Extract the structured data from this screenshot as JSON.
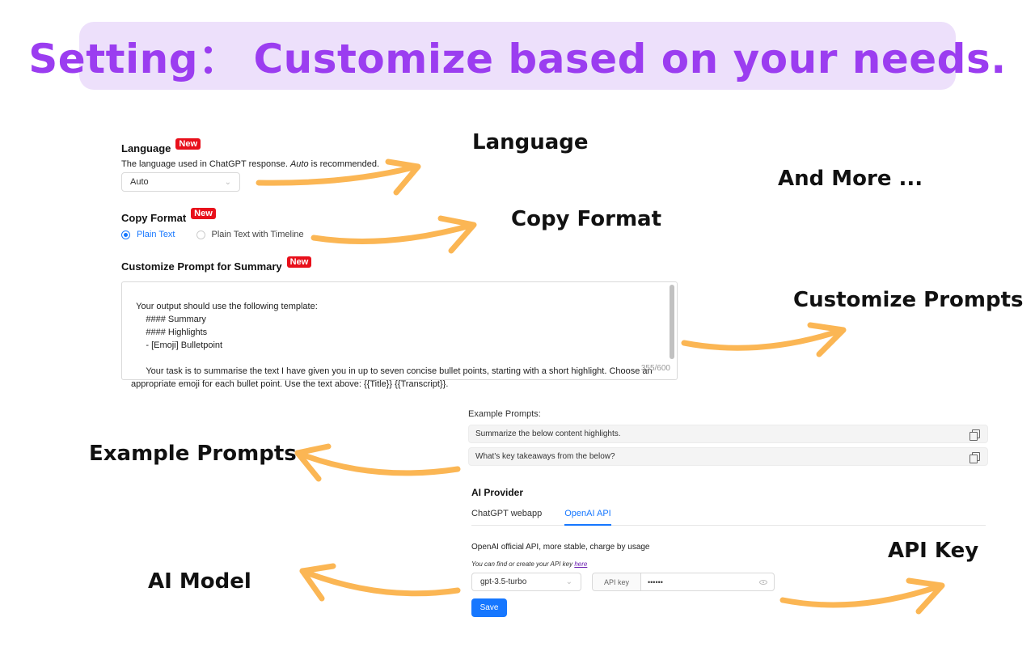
{
  "banner": {
    "title": "Setting： Customize based on your needs."
  },
  "callouts": {
    "language": "Language",
    "copy_format": "Copy Format",
    "and_more": "And More ...",
    "customize_prompts": "Customize Prompts",
    "example_prompts": "Example Prompts",
    "api_key": "API Key",
    "ai_model": "AI Model"
  },
  "settings": {
    "badge": "New",
    "language": {
      "label": "Language",
      "desc_pre": "The language used in ChatGPT response. ",
      "desc_em": "Auto",
      "desc_post": " is recommended.",
      "selected": "Auto"
    },
    "copy_format": {
      "label": "Copy Format",
      "options": [
        "Plain Text",
        "Plain Text with Timeline"
      ],
      "selected": "Plain Text"
    },
    "prompt": {
      "label": "Customize Prompt for Summary",
      "text": "Your output should use the following template:\n      #### Summary\n      #### Highlights\n      - [Emoji] Bulletpoint\n\n      Your task is to summarise the text I have given you in up to seven concise bullet points, starting with a short highlight. Choose an appropriate emoji for each bullet point. Use the text above: {{Title}} {{Transcript}}.",
      "counter": "355/600"
    }
  },
  "examples": {
    "title": "Example Prompts:",
    "items": [
      "Summarize the below content highlights.",
      "What's key takeaways from the below?"
    ]
  },
  "provider": {
    "title": "AI Provider",
    "tabs": [
      "ChatGPT webapp",
      "OpenAI API"
    ],
    "active_tab": "OpenAI API",
    "desc": "OpenAI official API, more stable, charge by usage",
    "hint_pre": "You can find or create your API key ",
    "hint_link": "here",
    "model": "gpt-3.5-turbo",
    "api_key_label": "API key",
    "api_key_value": "••••••",
    "save_label": "Save"
  },
  "colors": {
    "accent": "#9b3df0",
    "banner_bg": "#ede0fb",
    "arrow": "#fbb654",
    "primary": "#1677ff",
    "badge": "#e8101b"
  }
}
